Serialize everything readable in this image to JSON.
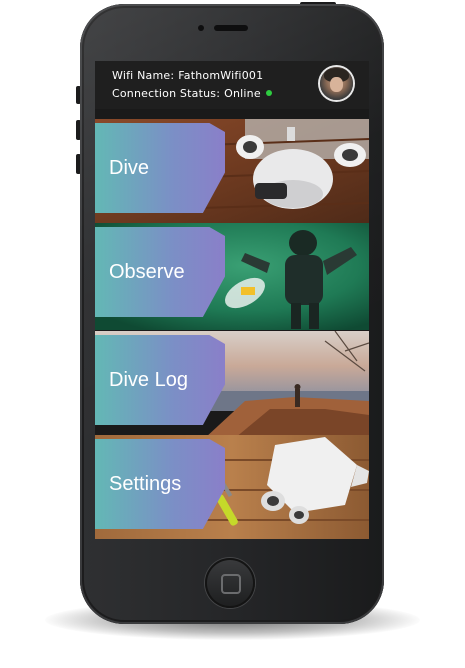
{
  "status": {
    "wifi_label": "Wifi Name:",
    "wifi_value": "FathomWifi001",
    "connection_label": "Connection Status:",
    "connection_value": "Online",
    "online_color": "#2ecc40"
  },
  "profile": {
    "avatar_icon": "user-avatar-photo"
  },
  "menu": {
    "items": [
      {
        "label": "Dive",
        "image": "drone-on-dock"
      },
      {
        "label": "Observe",
        "image": "diver-underwater"
      },
      {
        "label": "Dive Log",
        "image": "shoreline-person"
      },
      {
        "label": "Settings",
        "image": "drone-on-workbench"
      }
    ]
  },
  "theme": {
    "label_gradient_start": "#63b8b5",
    "label_gradient_end": "#8a7fc9"
  },
  "device": {
    "home_button_icon": "home-button-icon"
  }
}
